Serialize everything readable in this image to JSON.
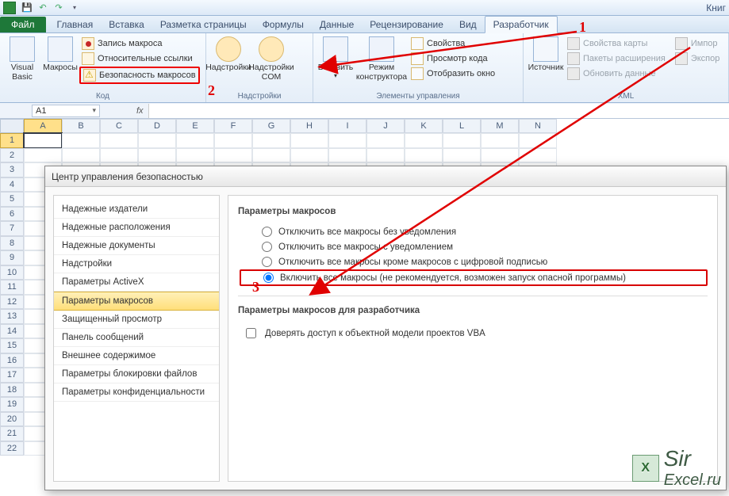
{
  "app": {
    "doc_title": "Книг"
  },
  "qat": {
    "save": "save",
    "undo": "undo",
    "redo": "redo"
  },
  "tabs": {
    "file": "Файл",
    "items": [
      {
        "label": "Главная"
      },
      {
        "label": "Вставка"
      },
      {
        "label": "Разметка страницы"
      },
      {
        "label": "Формулы"
      },
      {
        "label": "Данные"
      },
      {
        "label": "Рецензирование"
      },
      {
        "label": "Вид"
      },
      {
        "label": "Разработчик"
      }
    ],
    "active_index": 7
  },
  "ribbon": {
    "code": {
      "visual_basic": "Visual\nBasic",
      "macros": "Макросы",
      "record": "Запись макроса",
      "relative": "Относительные ссылки",
      "security": "Безопасность макросов",
      "group": "Код"
    },
    "addins": {
      "addins": "Надстройки",
      "com": "Надстройки\nCOM",
      "group": "Надстройки"
    },
    "controls": {
      "insert": "Вставить",
      "design": "Режим\nконструктора",
      "props": "Свойства",
      "viewcode": "Просмотр кода",
      "show": "Отобразить окно",
      "group": "Элементы управления"
    },
    "xml": {
      "source": "Источник",
      "mapprops": "Свойства карты",
      "ext": "Пакеты расширения",
      "refresh": "Обновить данные",
      "import": "Импор",
      "export": "Экспор",
      "group": "XML"
    }
  },
  "namebox": {
    "value": "A1",
    "fx": "fx"
  },
  "columns": [
    "A",
    "B",
    "C",
    "D",
    "E",
    "F",
    "G",
    "H",
    "I",
    "J",
    "K",
    "L",
    "M",
    "N"
  ],
  "rows_count": 22,
  "active_cell": {
    "row": 1,
    "col": "A"
  },
  "dialog": {
    "title": "Центр управления безопасностью",
    "nav": [
      "Надежные издатели",
      "Надежные расположения",
      "Надежные документы",
      "Надстройки",
      "Параметры ActiveX",
      "Параметры макросов",
      "Защищенный просмотр",
      "Панель сообщений",
      "Внешнее содержимое",
      "Параметры блокировки файлов",
      "Параметры конфиденциальности"
    ],
    "nav_selected": 5,
    "section1": "Параметры макросов",
    "radios": [
      "Отключить все макросы без уведомления",
      "Отключить все макросы с уведомлением",
      "Отключить все макросы кроме макросов с цифровой подписью",
      "Включить все макросы (не рекомендуется, возможен запуск опасной программы)"
    ],
    "radio_selected": 3,
    "section2": "Параметры макросов для разработчика",
    "check": "Доверять доступ к объектной модели проектов VBA"
  },
  "annotations": {
    "n1": "1",
    "n2": "2",
    "n3": "3"
  },
  "watermark": {
    "line1": "Sir",
    "line2": "Excel.ru"
  }
}
